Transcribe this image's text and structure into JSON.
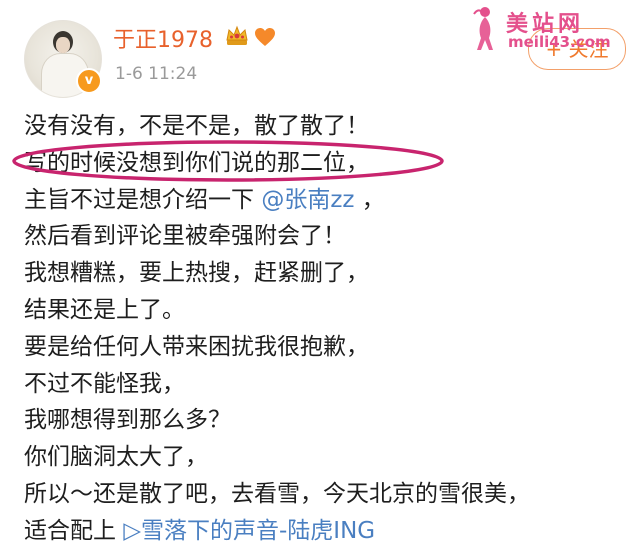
{
  "profile": {
    "username": "于正1978",
    "timestamp": "1-6 11:24",
    "verified_symbol": "v"
  },
  "header": {
    "follow_label": "+ 关注"
  },
  "watermark": {
    "title": "美站网",
    "url": "meili43.com"
  },
  "post": {
    "lines": [
      "没有没有，不是不是，散了散了！",
      "写的时候没想到你们说的那二位，",
      "主旨不过是想介绍一下",
      "然后看到评论里被牵强附会了！",
      "我想糟糕，要上热搜，赶紧删了，",
      "结果还是上了。",
      "要是给任何人带来困扰我很抱歉，",
      "不过不能怪我，",
      "我哪想得到那么多？",
      "你们脑洞太大了，",
      "所以～还是散了吧，去看雪，今天北京的雪很美，",
      "适合配上"
    ],
    "mention": "@张南zz",
    "line3_suffix": "，",
    "music_link": "▷雪落下的声音-陆虎ING"
  },
  "colors": {
    "username": "#e8612c",
    "link": "#4a7fc1",
    "highlight_ellipse": "#c8246e",
    "watermark": "#e4508c",
    "verified_badge": "#f79a1e"
  },
  "icons": {
    "crown": "crown-icon",
    "heart": "heart-icon",
    "verified": "verified-badge-icon",
    "music": "play-icon"
  }
}
